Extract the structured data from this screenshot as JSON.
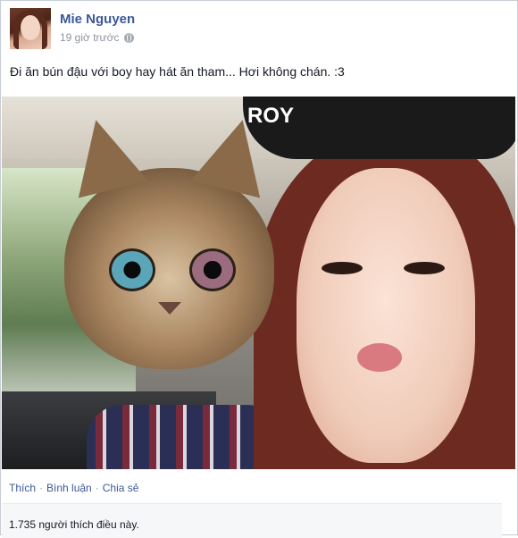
{
  "post": {
    "author": "Mie Nguyen",
    "timestamp": "19 giờ trước",
    "privacy_icon": "globe-icon",
    "status_text": "Đi ăn bún đậu với boy hay hát ăn tham... Hơi không chán. :3",
    "photo": {
      "cap_text": "ROY"
    },
    "actions": [
      {
        "label": "Thích"
      },
      {
        "label": "Bình luận"
      },
      {
        "label": "Chia sẻ"
      }
    ],
    "likes_text": "1.735 người thích điều này."
  },
  "colors": {
    "link": "#3b5998",
    "meta": "#90949c",
    "border": "#c8ccd4"
  }
}
